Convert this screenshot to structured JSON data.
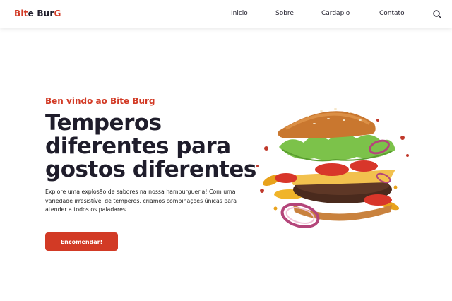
{
  "header": {
    "logo": {
      "part1": "Bit",
      "part2": "e Bur",
      "part3": "G"
    },
    "nav": [
      {
        "label": "Inicio"
      },
      {
        "label": "Sobre"
      },
      {
        "label": "Cardapio"
      },
      {
        "label": "Contato"
      }
    ],
    "search_icon": "search-icon"
  },
  "hero": {
    "greeting": "Ben vindo ao Bite Burg",
    "headline": "Temperos diferentes para gostos diferentes",
    "description": "Explore uma explosão de sabores na nossa hamburgueria! Com uma variedade irresistível de temperos, criamos combinações únicas para atender a todos os paladares.",
    "cta_label": "Encomendar!",
    "image_alt": "burger"
  },
  "colors": {
    "accent": "#d23a25",
    "text": "#1f1d2b",
    "background": "#ffffff"
  }
}
